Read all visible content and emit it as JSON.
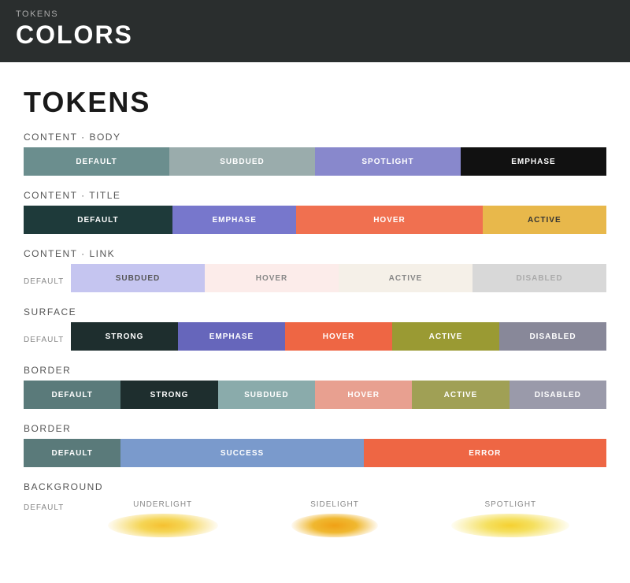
{
  "header": {
    "subtitle": "TOKENS",
    "title": "COLORS"
  },
  "page": {
    "title": "TOKENS"
  },
  "sections": {
    "content_body": {
      "label": "CONTENT · BODY",
      "swatches": [
        {
          "id": "cb-default",
          "label": "DEFAULT",
          "bg": "#6b8e8e",
          "color": "white"
        },
        {
          "id": "cb-subdued",
          "label": "SUBDUED",
          "bg": "#9aacac",
          "color": "white"
        },
        {
          "id": "cb-spotlight",
          "label": "SPOTLIGHT",
          "bg": "#8888cc",
          "color": "white"
        },
        {
          "id": "cb-emphase",
          "label": "EMPHASE",
          "bg": "#111111",
          "color": "white"
        }
      ]
    },
    "content_title": {
      "label": "CONTENT · TITLE",
      "swatches": [
        {
          "id": "ct-default",
          "label": "DEFAULT",
          "bg": "#1e3a3a",
          "color": "white"
        },
        {
          "id": "ct-emphase",
          "label": "EMPHASE",
          "bg": "#7777cc",
          "color": "white"
        },
        {
          "id": "ct-hover",
          "label": "HOVER",
          "bg": "#f07050",
          "color": "white"
        },
        {
          "id": "ct-active",
          "label": "ACTIVE",
          "bg": "#e8b84b",
          "color": "#333"
        }
      ]
    },
    "content_link": {
      "label": "CONTENT · LINK",
      "sub_label": "DEFAULT",
      "swatches": [
        {
          "id": "cl-subdued",
          "label": "SUBDUED",
          "bg": "#c5c5f0",
          "color": "#555"
        },
        {
          "id": "cl-hover",
          "label": "HOVER",
          "bg": "#fcecea",
          "color": "#888"
        },
        {
          "id": "cl-active",
          "label": "ACTIVE",
          "bg": "#f5f0e8",
          "color": "#888"
        },
        {
          "id": "cl-disabled",
          "label": "DISABLED",
          "bg": "#d8d8d8",
          "color": "#aaa"
        }
      ]
    },
    "surface": {
      "label": "SURFACE",
      "sub_label": "DEFAULT",
      "swatches": [
        {
          "id": "sf-strong",
          "label": "STRONG",
          "bg": "#1e2e2e",
          "color": "white"
        },
        {
          "id": "sf-emphase",
          "label": "EMPHASE",
          "bg": "#6666bb",
          "color": "white"
        },
        {
          "id": "sf-hover",
          "label": "HOVER",
          "bg": "#ee6644",
          "color": "white"
        },
        {
          "id": "sf-active",
          "label": "ACTIVE",
          "bg": "#9a9a33",
          "color": "white"
        },
        {
          "id": "sf-disabled",
          "label": "DISABLED",
          "bg": "#888899",
          "color": "white"
        }
      ]
    },
    "border1": {
      "label": "BORDER",
      "swatches": [
        {
          "id": "br1-default",
          "label": "DEFAULT",
          "bg": "#5a7a7a",
          "color": "white"
        },
        {
          "id": "br1-strong",
          "label": "STRONG",
          "bg": "#1e2e2e",
          "color": "white"
        },
        {
          "id": "br1-subdued",
          "label": "SUBDUED",
          "bg": "#8aabab",
          "color": "white"
        },
        {
          "id": "br1-hover",
          "label": "HOVER",
          "bg": "#e8a090",
          "color": "white"
        },
        {
          "id": "br1-active",
          "label": "ACTIVE",
          "bg": "#a0a055",
          "color": "white"
        },
        {
          "id": "br1-disabled",
          "label": "DISABLED",
          "bg": "#9a9aaa",
          "color": "white"
        }
      ]
    },
    "border2": {
      "label": "BORDER",
      "swatches": [
        {
          "id": "br2-default",
          "label": "DEFAULT",
          "bg": "#5a7a7a",
          "color": "white"
        },
        {
          "id": "br2-success",
          "label": "SUCCESS",
          "bg": "#7a9acc",
          "color": "white"
        },
        {
          "id": "br2-error",
          "label": "ERROR",
          "bg": "#ee6644",
          "color": "white"
        }
      ]
    },
    "background": {
      "label": "BACKGROUND",
      "sub_label": "DEFAULT",
      "items": [
        {
          "id": "bg-underlight",
          "label": "UNDERLIGHT"
        },
        {
          "id": "bg-sidelight",
          "label": "SIDELIGHT"
        },
        {
          "id": "bg-spotlight",
          "label": "SPOTLIGHT"
        }
      ]
    }
  }
}
